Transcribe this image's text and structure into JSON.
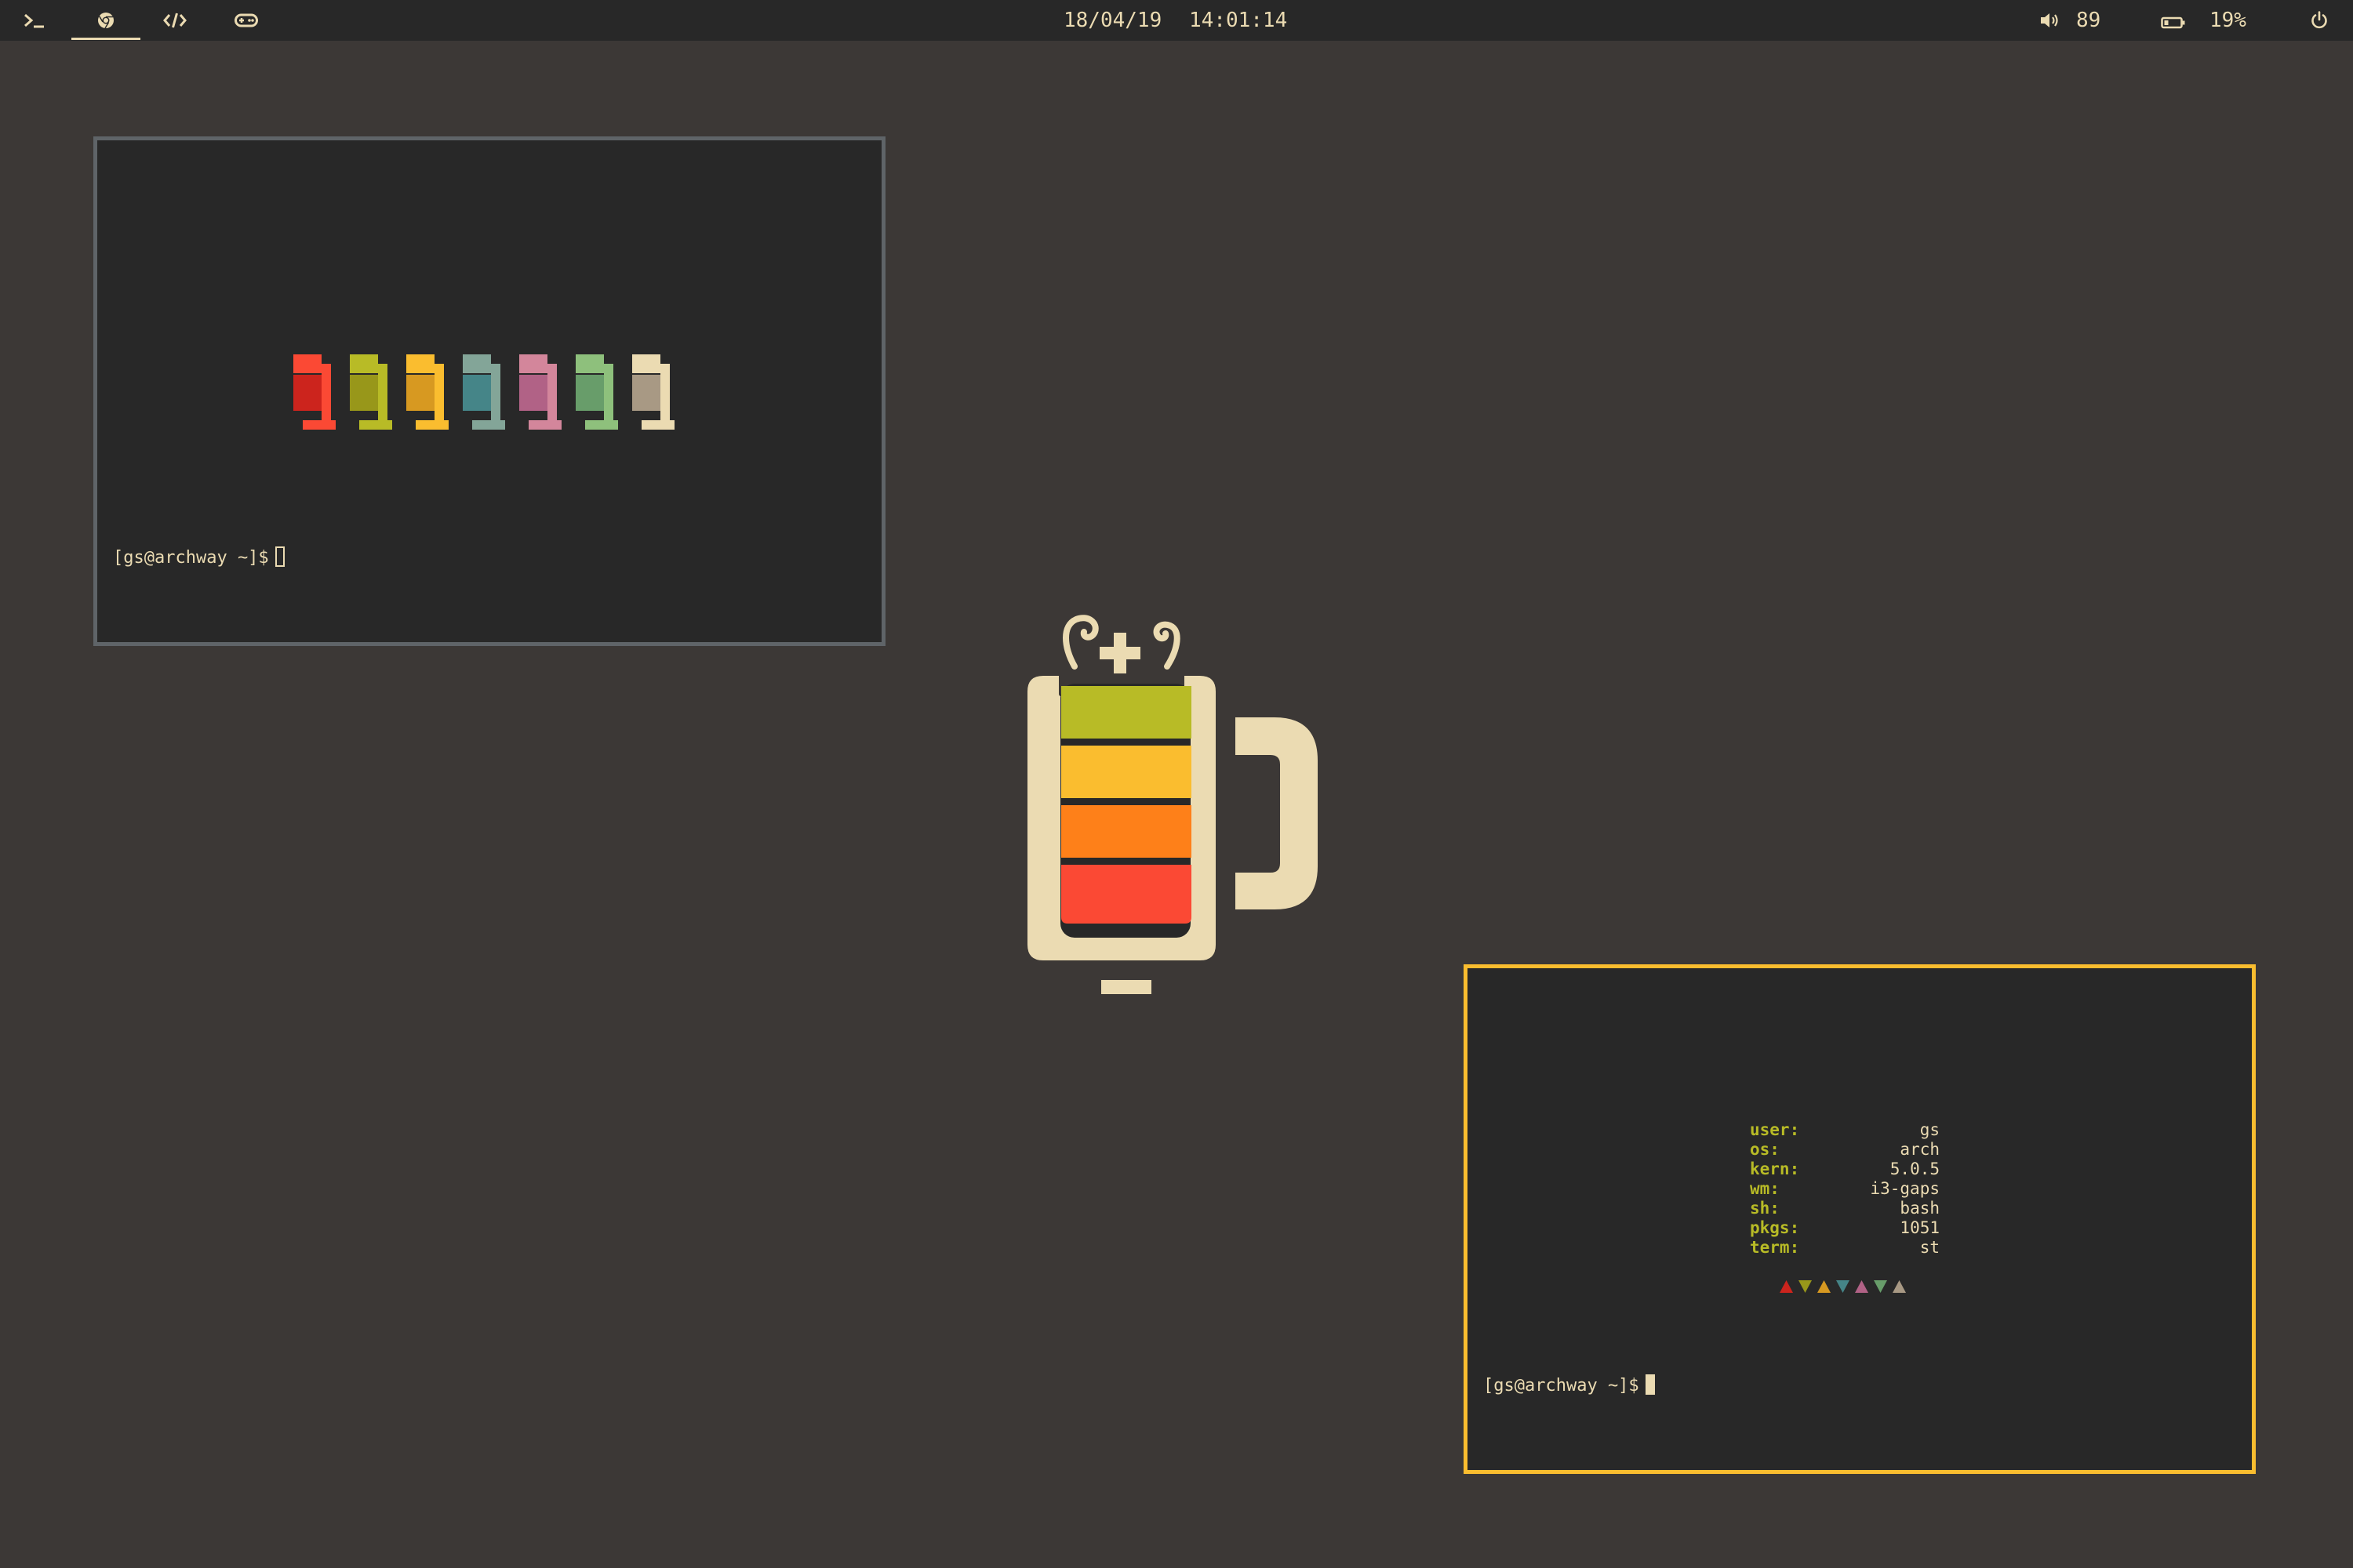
{
  "topbar": {
    "workspaces": [
      {
        "name": "terminal",
        "icon": "terminal-icon",
        "active": false
      },
      {
        "name": "browser",
        "icon": "chrome-icon",
        "active": true
      },
      {
        "name": "code",
        "icon": "code-icon",
        "active": false
      },
      {
        "name": "games",
        "icon": "gamepad-icon",
        "active": false
      }
    ],
    "date": "18/04/19",
    "time": "14:01:14",
    "volume": "89",
    "battery": "19%"
  },
  "terminal1": {
    "prompt": "[gs@archway ~]$",
    "block_colors": [
      "#fb4934",
      "#b8bb26",
      "#fabd2f",
      "#83a598",
      "#d3869b",
      "#8ec07c",
      "#ebdbb2"
    ],
    "block_dark_colors": [
      "#cc241d",
      "#98971a",
      "#d79921",
      "#458588",
      "#b16286",
      "#689d6a",
      "#a89984"
    ]
  },
  "terminal2": {
    "info": [
      {
        "key": "user:",
        "value": "gs"
      },
      {
        "key": "os:",
        "value": "arch"
      },
      {
        "key": "kern:",
        "value": "5.0.5"
      },
      {
        "key": "wm:",
        "value": "i3-gaps"
      },
      {
        "key": "sh:",
        "value": "bash"
      },
      {
        "key": "pkgs:",
        "value": "1051"
      },
      {
        "key": "term:",
        "value": "st"
      }
    ],
    "triangle_colors": [
      "#cc241d",
      "#98971a",
      "#d79921",
      "#458588",
      "#b16286",
      "#689d6a",
      "#a89984"
    ],
    "prompt": "[gs@archway ~]$"
  },
  "colors": {
    "desktop_bg": "#3c3836",
    "bar_bg": "#282828",
    "fg": "#ebdbb2",
    "focused_border": "#fabd2f",
    "unfocused_border": "#5f6468",
    "mug": "#ebdbb2",
    "liquid": [
      "#b8bb26",
      "#fabd2f",
      "#fe8019",
      "#fb4934"
    ]
  }
}
